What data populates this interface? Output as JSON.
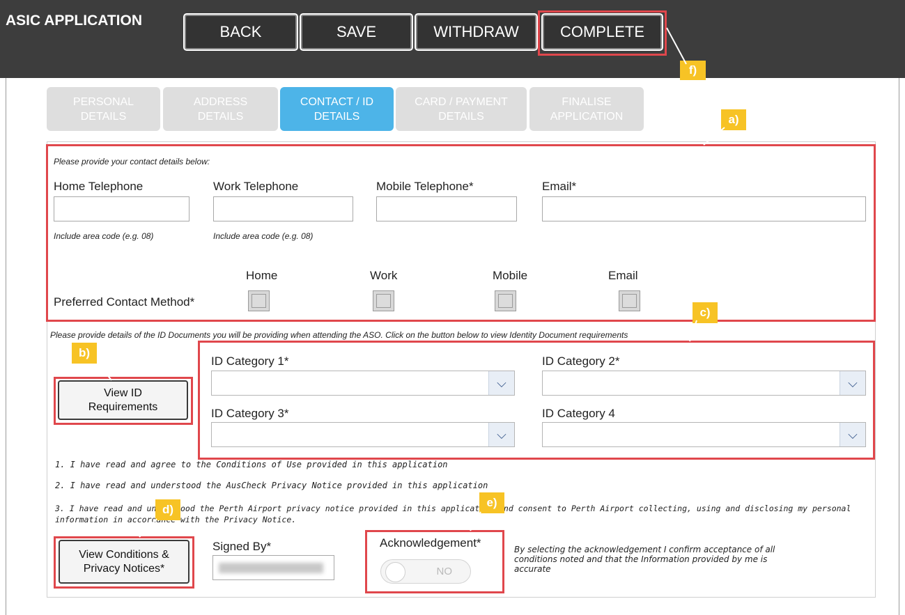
{
  "header": {
    "title": "ASIC APPLICATION",
    "buttons": {
      "back": "BACK",
      "save": "SAVE",
      "withdraw": "WITHDRAW",
      "complete": "COMPLETE"
    }
  },
  "tabs": [
    {
      "line1": "PERSONAL",
      "line2": "DETAILS"
    },
    {
      "line1": "ADDRESS",
      "line2": "DETAILS"
    },
    {
      "line1": "CONTACT / ID",
      "line2": "DETAILS"
    },
    {
      "line1": "CARD / PAYMENT",
      "line2": "DETAILS"
    },
    {
      "line1": "FINALISE",
      "line2": "APPLICATION"
    }
  ],
  "callouts": {
    "a": "a)",
    "b": "b)",
    "c": "c)",
    "d": "d)",
    "e": "e)",
    "f": "f)"
  },
  "contact": {
    "intro": "Please provide your contact details below:",
    "home_label": "Home Telephone",
    "work_label": "Work Telephone",
    "mobile_label": "Mobile Telephone*",
    "email_label": "Email*",
    "home_value": "",
    "work_value": "",
    "mobile_value": "",
    "email_value": "",
    "area_hint": "Include area code (e.g. 08)",
    "preferred_label": "Preferred Contact Method*",
    "methods": {
      "home": "Home",
      "work": "Work",
      "mobile": "Mobile",
      "email": "Email"
    }
  },
  "id_docs": {
    "intro": "Please provide details of the ID Documents you will be providing when attending the ASO. Click on the button below to view Identity Document requirements",
    "view_button_line1": "View ID",
    "view_button_line2": "Requirements",
    "cat1_label": "ID Category 1*",
    "cat2_label": "ID Category 2*",
    "cat3_label": "ID Category 3*",
    "cat4_label": "ID Category 4",
    "cat1_value": "",
    "cat2_value": "",
    "cat3_value": "",
    "cat4_value": ""
  },
  "declarations": {
    "item1": "1. I have read and agree to the Conditions of Use provided in this application",
    "item2": "2. I have read and understood the AusCheck Privacy Notice provided in this application",
    "item3_line1": "3. I have read and understood the Perth Airport privacy notice provided in this application and consent to Perth Airport collecting, using and disclosing my personal",
    "item3_line2": "information in accordance with the Privacy Notice."
  },
  "finalise": {
    "view_conditions_line1": "View Conditions &",
    "view_conditions_line2": "Privacy Notices*",
    "signed_by_label": "Signed By*",
    "acknowledgement_label": "Acknowledgement*",
    "toggle_state": "NO",
    "acknowledgement_text_line1": "By selecting the acknowledgement I confirm acceptance of all",
    "acknowledgement_text_line2": "conditions noted and that the Information provided by me is",
    "acknowledgement_text_line3": "accurate"
  },
  "colors": {
    "header_bg": "#3d3d3d",
    "active_tab": "#4db4e8",
    "inactive_tab": "#dedede",
    "highlight_red": "#e0474c",
    "callout_yellow": "#f7c325"
  }
}
